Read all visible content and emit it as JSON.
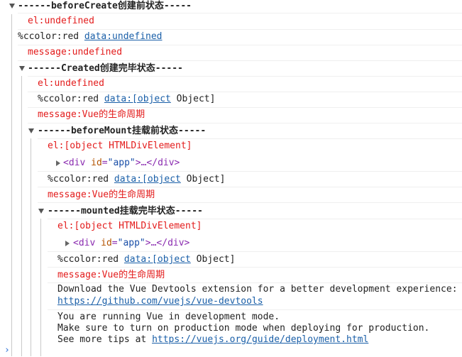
{
  "groups": {
    "beforeCreate": "------beforeCreate创建前状态-----",
    "created": "------Created创建完毕状态-----",
    "beforeMount": "------beforeMount挂载前状态-----",
    "mounted": "------mounted挂载完毕状态-----"
  },
  "lines": {
    "bc_el": "el:undefined",
    "bc_data_prefix": "%ccolor:red ",
    "bc_data_link": "data:undefined",
    "bc_msg": "message:undefined",
    "cr_el": "el:undefined",
    "cr_data_prefix": "%ccolor:red ",
    "cr_data_link": "data:[object",
    "cr_data_suffix": " Object]",
    "cr_msg": "message:Vue的生命周期",
    "bm_el": "el:[object HTMLDivElement]",
    "bm_div_open": "<div",
    "bm_div_attr": "id",
    "bm_div_val": "\"app\"",
    "bm_div_close": ">…</div>",
    "bm_data_prefix": "%ccolor:red ",
    "bm_data_link": "data:[object",
    "bm_data_suffix": " Object]",
    "bm_msg": "message:Vue的生命周期",
    "mo_el": "el:[object HTMLDivElement]",
    "mo_div_open": "<div",
    "mo_div_attr": "id",
    "mo_div_val": "\"app\"",
    "mo_div_close": ">…</div>",
    "mo_data_prefix": "%ccolor:red ",
    "mo_data_link": "data:[object",
    "mo_data_suffix": " Object]",
    "mo_msg": "message:Vue的生命周期"
  },
  "devtools": {
    "line1": "Download the Vue Devtools extension for a better development experience:",
    "link": "https://github.com/vuejs/vue-devtools"
  },
  "devmode": {
    "line1": "You are running Vue in development mode.",
    "line2": "Make sure to turn on production mode when deploying for production.",
    "line3_prefix": "See more tips at ",
    "link": "https://vuejs.org/guide/deployment.html"
  },
  "prompt": {
    "glyph": "›"
  }
}
